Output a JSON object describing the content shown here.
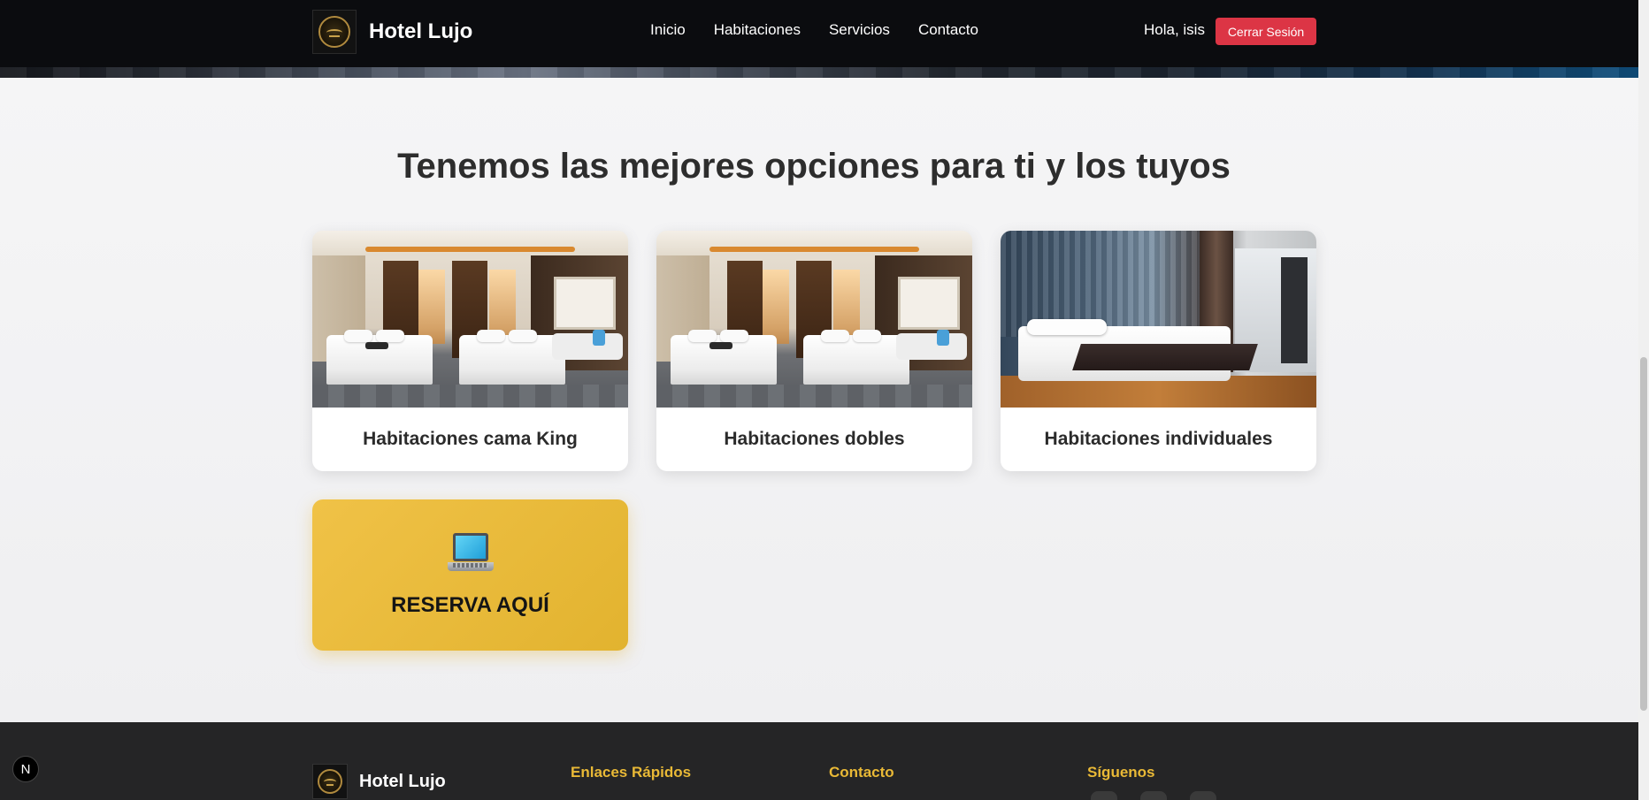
{
  "navbar": {
    "brand": "Hotel Lujo",
    "links": [
      "Inicio",
      "Habitaciones",
      "Servicios",
      "Contacto"
    ],
    "greeting": "Hola, isis",
    "logout_label": "Cerrar Sesión",
    "logout_color": "#dc3545"
  },
  "main": {
    "title": "Tenemos las mejores opciones para ti y los tuyos",
    "rooms": [
      {
        "label": "Habitaciones cama King"
      },
      {
        "label": "Habitaciones dobles"
      },
      {
        "label": "Habitaciones individuales"
      }
    ],
    "reserve": {
      "label": "RESERVA AQUÍ",
      "icon": "laptop-icon",
      "color": "#e2b32f"
    }
  },
  "footer": {
    "brand": "Hotel Lujo",
    "headings": [
      "Enlaces Rápidos",
      "Contacto",
      "Síguenos"
    ],
    "heading_color": "#e9b936"
  },
  "next_badge": "N"
}
